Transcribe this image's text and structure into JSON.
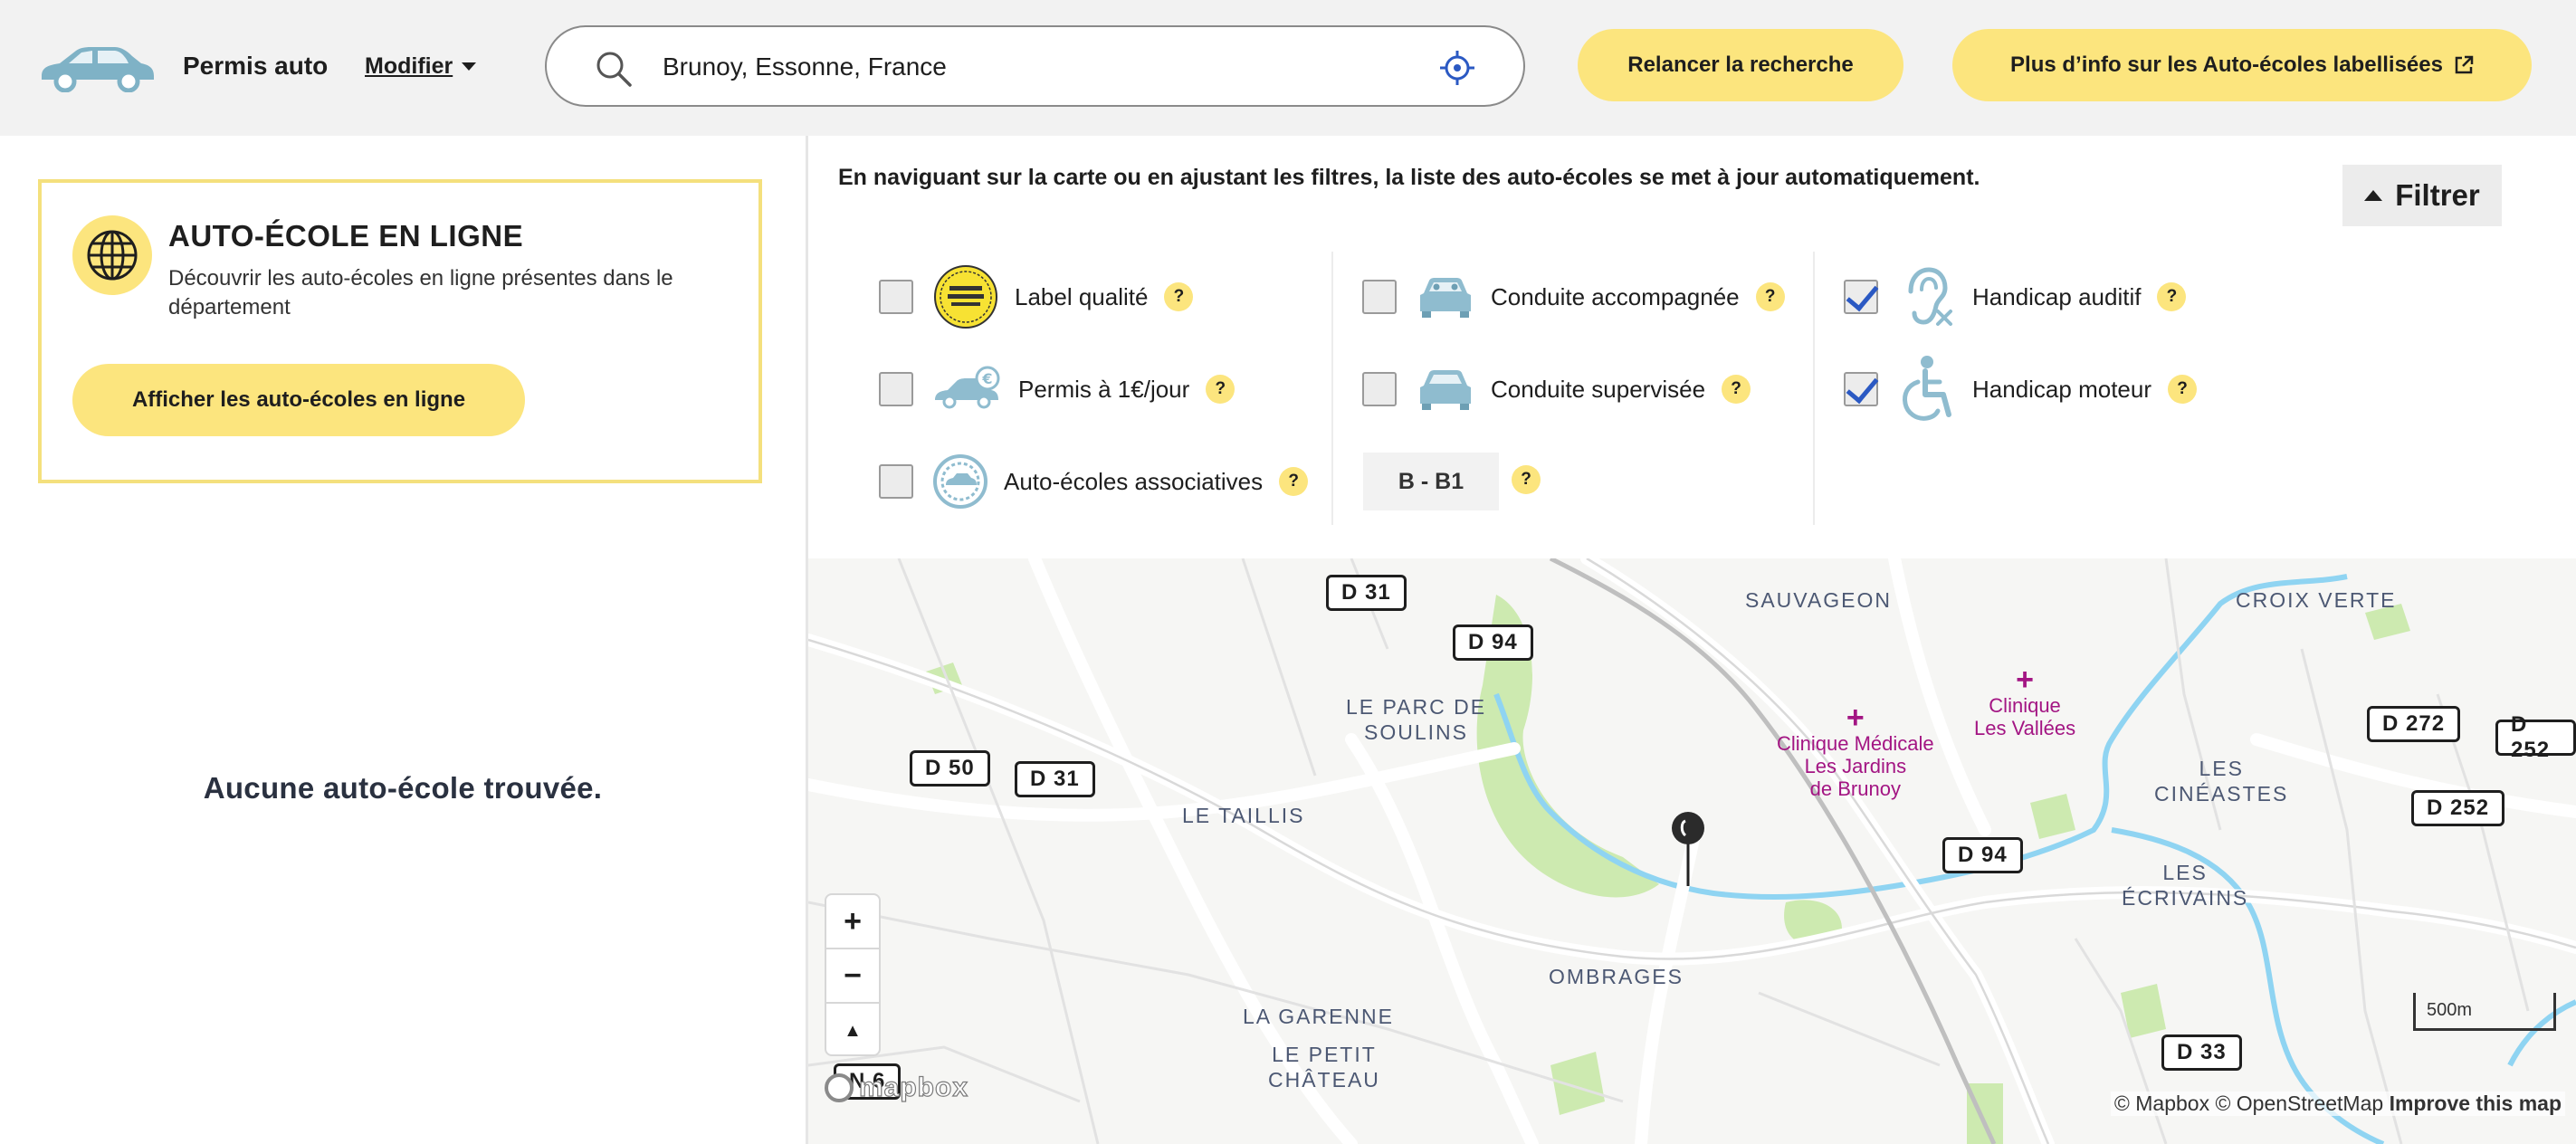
{
  "header": {
    "brand": "Permis auto",
    "modifier_label": "Modifier",
    "search": {
      "value": "Brunoy, Essonne, France",
      "placeholder": ""
    },
    "relancer_label": "Relancer la recherche",
    "info_label": "Plus d’info sur les Auto-écoles labellisées"
  },
  "online_card": {
    "title": "AUTO-ÉCOLE EN LIGNE",
    "description": "Découvrir les auto-écoles en ligne présentes dans le département",
    "button_label": "Afficher les auto-écoles en ligne"
  },
  "results": {
    "empty_message": "Aucune auto-école trouvée."
  },
  "filters": {
    "info": "En naviguant sur la carte ou en ajustant les filtres, la liste des auto-écoles se met à jour automatiquement.",
    "toggle_label": "Filtrer",
    "help": "?",
    "items": [
      {
        "label": "Label qualité",
        "checked": false,
        "icon": "quality-label-icon"
      },
      {
        "label": "Permis à 1€/jour",
        "checked": false,
        "icon": "euro-car-icon"
      },
      {
        "label": "Auto-écoles associatives",
        "checked": false,
        "icon": "association-seal-icon"
      },
      {
        "label": "Conduite accompagnée",
        "checked": false,
        "icon": "car-front-icon"
      },
      {
        "label": "Conduite supervisée",
        "checked": false,
        "icon": "car-front-icon"
      },
      {
        "label": "Handicap auditif",
        "checked": true,
        "icon": "hearing-impaired-icon"
      },
      {
        "label": "Handicap moteur",
        "checked": true,
        "icon": "wheelchair-icon"
      }
    ],
    "license_select": "B - B1"
  },
  "map": {
    "roads": [
      "D 31",
      "D 94",
      "D 50",
      "D 31",
      "D 94",
      "D 272",
      "D 252",
      "D 252",
      "D 33",
      "N 6"
    ],
    "places": [
      "SAUVAGEON",
      "CROIX VERTE",
      "LE PARC DE",
      "SOULINS",
      "LE TAILLIS",
      "LES",
      "CINÉASTES",
      "LES",
      "ÉCRIVAINS",
      "OMBRAGES",
      "LA GARENNE",
      "LE PETIT",
      "CHÂTEAU"
    ],
    "clinics": [
      {
        "l1": "Clinique Médicale",
        "l2": "Les Jardins",
        "l3": "de Brunoy"
      },
      {
        "l1": "Clinique",
        "l2": "Les Vallées"
      }
    ],
    "zoom_in": "+",
    "zoom_out": "−",
    "compass": "▲",
    "scale": "500m",
    "logo": "mapbox",
    "attribution": "© Mapbox © OpenStreetMap",
    "improve": "Improve this map",
    "colors": {
      "water": "#8fd4f2",
      "park": "#cdeab0",
      "clinic": "#a31583",
      "accent": "#fce57e"
    }
  }
}
